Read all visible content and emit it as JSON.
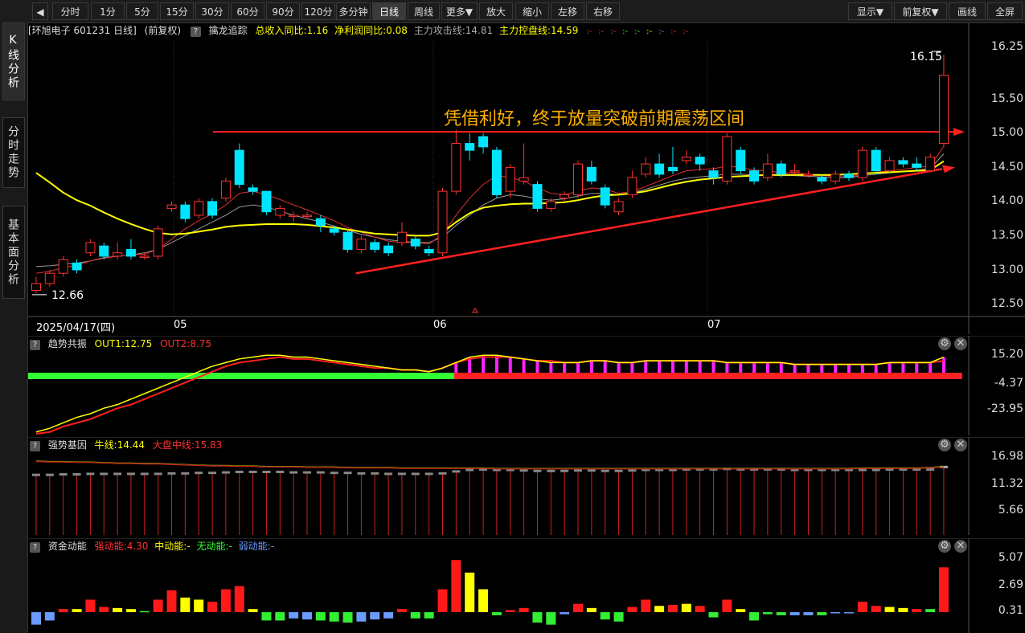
{
  "toolbar": {
    "back_icon": "◀",
    "periods": [
      "分时",
      "1分",
      "5分",
      "15分",
      "30分",
      "60分",
      "90分",
      "120分",
      "多分钟",
      "日线",
      "周线",
      "更多▼",
      "放大",
      "缩小",
      "左移",
      "右移"
    ],
    "active_period": "日线",
    "right": [
      "显示▼",
      "前复权▼",
      "画线",
      "全屏"
    ]
  },
  "sidebar": {
    "tabs": [
      "K线分析",
      "分时走势",
      "基本面分析"
    ],
    "active": 0
  },
  "main": {
    "header": {
      "stock": "[环旭电子 601231 日线]",
      "adjust": "(前复权)",
      "indicator": "擒龙追踪",
      "items": [
        {
          "text": "总收入同比:1.16",
          "color": "#ffff00"
        },
        {
          "text": "净利润同比:0.08",
          "color": "#ffff00"
        },
        {
          "text": "主力攻击线:14.81",
          "color": "#bbbbbb"
        },
        {
          "text": "主力控盘线:14.59",
          "color": "#ffff00"
        }
      ],
      "dashes": [
        ":-",
        ":-",
        ":-",
        ":-",
        ":-",
        ":-",
        ":-",
        ":-",
        ":-"
      ]
    },
    "annotation": "凭借利好，终于放量突破前期震荡区间",
    "high_label": "16.15",
    "low_label": "12.66",
    "y_ticks": [
      "16.25",
      "15.50",
      "15.00",
      "14.50",
      "14.00",
      "13.50",
      "13.00",
      "12.50"
    ],
    "date_labels": [
      "2025/04/17(四)",
      "05",
      "06",
      "07"
    ]
  },
  "panel2": {
    "name": "趋势共振",
    "out1": "OUT1:12.75",
    "out2": "OUT2:8.75",
    "y_ticks": [
      "15.20",
      "-4.37",
      "-23.95"
    ]
  },
  "panel3": {
    "name": "强势基因",
    "bull": "牛线:14.44",
    "market": "大盘中线:15.83",
    "y_ticks": [
      "16.98",
      "11.32",
      "5.66"
    ]
  },
  "panel4": {
    "name": "资金动能",
    "strong": "强动能:4.30",
    "mid": "中动能:-",
    "none": "无动能:-",
    "weak": "弱动能:-",
    "y_ticks": [
      "5.07",
      "2.69",
      "0.31"
    ]
  },
  "colors": {
    "up": "#ff3232",
    "down": "#00e5ff",
    "ma_yellow": "#ffff00",
    "annotation": "#ffb000",
    "arrow": "#ff2020"
  },
  "chart_data": {
    "type": "candlestick",
    "candles": [
      {
        "o": 12.7,
        "c": 12.8,
        "h": 12.9,
        "l": 12.66
      },
      {
        "o": 12.8,
        "c": 12.95,
        "h": 13.0,
        "l": 12.75
      },
      {
        "o": 12.95,
        "c": 13.15,
        "h": 13.2,
        "l": 12.9
      },
      {
        "o": 13.1,
        "c": 13.0,
        "h": 13.15,
        "l": 12.95
      },
      {
        "o": 13.25,
        "c": 13.4,
        "h": 13.45,
        "l": 13.2
      },
      {
        "o": 13.35,
        "c": 13.2,
        "h": 13.4,
        "l": 13.15
      },
      {
        "o": 13.2,
        "c": 13.25,
        "h": 13.4,
        "l": 13.15
      },
      {
        "o": 13.3,
        "c": 13.2,
        "h": 13.45,
        "l": 13.15
      },
      {
        "o": 13.2,
        "c": 13.2,
        "h": 13.25,
        "l": 13.15
      },
      {
        "o": 13.2,
        "c": 13.6,
        "h": 13.65,
        "l": 13.15
      },
      {
        "o": 13.9,
        "c": 13.95,
        "h": 14.0,
        "l": 13.85
      },
      {
        "o": 13.95,
        "c": 13.75,
        "h": 14.0,
        "l": 13.7
      },
      {
        "o": 13.8,
        "c": 14.0,
        "h": 14.05,
        "l": 13.75
      },
      {
        "o": 14.0,
        "c": 13.8,
        "h": 14.05,
        "l": 13.75
      },
      {
        "o": 14.05,
        "c": 14.3,
        "h": 14.35,
        "l": 14.0
      },
      {
        "o": 14.75,
        "c": 14.25,
        "h": 14.85,
        "l": 14.2
      },
      {
        "o": 14.2,
        "c": 14.15,
        "h": 14.25,
        "l": 14.1
      },
      {
        "o": 14.15,
        "c": 13.85,
        "h": 14.15,
        "l": 13.8
      },
      {
        "o": 13.8,
        "c": 13.9,
        "h": 13.95,
        "l": 13.75
      },
      {
        "o": 13.8,
        "c": 13.8,
        "h": 13.85,
        "l": 13.7
      },
      {
        "o": 13.8,
        "c": 13.8,
        "h": 13.85,
        "l": 13.75
      },
      {
        "o": 13.75,
        "c": 13.65,
        "h": 13.8,
        "l": 13.55
      },
      {
        "o": 13.6,
        "c": 13.55,
        "h": 13.65,
        "l": 13.5
      },
      {
        "o": 13.55,
        "c": 13.3,
        "h": 13.6,
        "l": 13.25
      },
      {
        "o": 13.3,
        "c": 13.45,
        "h": 13.5,
        "l": 13.25
      },
      {
        "o": 13.4,
        "c": 13.3,
        "h": 13.45,
        "l": 13.25
      },
      {
        "o": 13.35,
        "c": 13.25,
        "h": 13.4,
        "l": 13.2
      },
      {
        "o": 13.4,
        "c": 13.55,
        "h": 13.7,
        "l": 13.35
      },
      {
        "o": 13.45,
        "c": 13.35,
        "h": 13.5,
        "l": 13.3
      },
      {
        "o": 13.3,
        "c": 13.25,
        "h": 13.35,
        "l": 13.2
      },
      {
        "o": 13.25,
        "c": 14.15,
        "h": 14.2,
        "l": 13.2
      },
      {
        "o": 14.15,
        "c": 14.85,
        "h": 15.05,
        "l": 14.1
      },
      {
        "o": 14.85,
        "c": 14.75,
        "h": 15.0,
        "l": 14.6
      },
      {
        "o": 14.95,
        "c": 14.8,
        "h": 15.0,
        "l": 14.7
      },
      {
        "o": 14.75,
        "c": 14.1,
        "h": 14.8,
        "l": 14.05
      },
      {
        "o": 14.15,
        "c": 14.5,
        "h": 14.55,
        "l": 14.05
      },
      {
        "o": 14.3,
        "c": 14.35,
        "h": 14.85,
        "l": 14.25
      },
      {
        "o": 14.25,
        "c": 13.9,
        "h": 14.3,
        "l": 13.85
      },
      {
        "o": 13.9,
        "c": 14.0,
        "h": 14.05,
        "l": 13.85
      },
      {
        "o": 14.05,
        "c": 14.1,
        "h": 14.15,
        "l": 14.0
      },
      {
        "o": 14.1,
        "c": 14.55,
        "h": 14.6,
        "l": 14.05
      },
      {
        "o": 14.5,
        "c": 14.3,
        "h": 14.6,
        "l": 14.25
      },
      {
        "o": 14.2,
        "c": 13.95,
        "h": 14.25,
        "l": 13.9
      },
      {
        "o": 13.85,
        "c": 14.0,
        "h": 14.05,
        "l": 13.8
      },
      {
        "o": 14.1,
        "c": 14.35,
        "h": 14.45,
        "l": 14.05
      },
      {
        "o": 14.4,
        "c": 14.55,
        "h": 14.65,
        "l": 14.35
      },
      {
        "o": 14.55,
        "c": 14.4,
        "h": 14.7,
        "l": 14.35
      },
      {
        "o": 14.5,
        "c": 14.45,
        "h": 14.8,
        "l": 14.4
      },
      {
        "o": 14.6,
        "c": 14.65,
        "h": 14.75,
        "l": 14.55
      },
      {
        "o": 14.65,
        "c": 14.55,
        "h": 14.7,
        "l": 14.45
      },
      {
        "o": 14.45,
        "c": 14.35,
        "h": 14.5,
        "l": 14.25
      },
      {
        "o": 14.3,
        "c": 14.95,
        "h": 15.0,
        "l": 14.25
      },
      {
        "o": 14.75,
        "c": 14.45,
        "h": 14.8,
        "l": 14.4
      },
      {
        "o": 14.45,
        "c": 14.3,
        "h": 14.5,
        "l": 14.25
      },
      {
        "o": 14.35,
        "c": 14.55,
        "h": 14.7,
        "l": 14.3
      },
      {
        "o": 14.55,
        "c": 14.4,
        "h": 14.6,
        "l": 14.35
      },
      {
        "o": 14.45,
        "c": 14.45,
        "h": 14.55,
        "l": 14.4
      },
      {
        "o": 14.4,
        "c": 14.4,
        "h": 14.45,
        "l": 14.35
      },
      {
        "o": 14.35,
        "c": 14.3,
        "h": 14.4,
        "l": 14.25
      },
      {
        "o": 14.3,
        "c": 14.4,
        "h": 14.45,
        "l": 14.25
      },
      {
        "o": 14.4,
        "c": 14.35,
        "h": 14.45,
        "l": 14.3
      },
      {
        "o": 14.35,
        "c": 14.75,
        "h": 14.8,
        "l": 14.3
      },
      {
        "o": 14.75,
        "c": 14.45,
        "h": 14.8,
        "l": 14.4
      },
      {
        "o": 14.45,
        "c": 14.6,
        "h": 14.65,
        "l": 14.4
      },
      {
        "o": 14.6,
        "c": 14.55,
        "h": 14.65,
        "l": 14.5
      },
      {
        "o": 14.55,
        "c": 14.5,
        "h": 14.65,
        "l": 14.45
      },
      {
        "o": 14.45,
        "c": 14.65,
        "h": 14.7,
        "l": 14.45
      },
      {
        "o": 14.85,
        "c": 15.85,
        "h": 16.15,
        "l": 14.8
      }
    ],
    "ma_yellow": [
      14.42,
      14.28,
      14.13,
      14.02,
      13.94,
      13.84,
      13.75,
      13.67,
      13.6,
      13.54,
      13.52,
      13.53,
      13.56,
      13.59,
      13.63,
      13.65,
      13.66,
      13.67,
      13.67,
      13.67,
      13.66,
      13.64,
      13.62,
      13.59,
      13.56,
      13.53,
      13.52,
      13.51,
      13.5,
      13.5,
      13.55,
      13.7,
      13.83,
      13.91,
      13.94,
      13.96,
      13.97,
      13.97,
      13.98,
      13.99,
      14.02,
      14.06,
      14.09,
      14.1,
      14.12,
      14.15,
      14.2,
      14.25,
      14.29,
      14.32,
      14.34,
      14.36,
      14.37,
      14.38,
      14.39,
      14.39,
      14.39,
      14.39,
      14.39,
      14.39,
      14.4,
      14.41,
      14.42,
      14.43,
      14.44,
      14.45,
      14.46,
      14.59
    ],
    "ma_red": [
      12.95,
      12.98,
      13.03,
      13.07,
      13.13,
      13.17,
      13.2,
      13.22,
      13.23,
      13.3,
      13.45,
      13.6,
      13.72,
      13.82,
      13.95,
      14.12,
      14.15,
      14.1,
      14.03,
      13.95,
      13.88,
      13.8,
      13.72,
      13.62,
      13.55,
      13.48,
      13.42,
      13.4,
      13.4,
      13.38,
      13.52,
      13.8,
      14.05,
      14.25,
      14.38,
      14.35,
      14.3,
      14.2,
      14.12,
      14.1,
      14.15,
      14.2,
      14.18,
      14.12,
      14.15,
      14.22,
      14.3,
      14.38,
      14.45,
      14.47,
      14.48,
      14.52,
      14.5,
      14.46,
      14.45,
      14.42,
      14.42,
      14.4,
      14.38,
      14.37,
      14.36,
      14.4,
      14.43,
      14.45,
      14.47,
      14.5,
      14.52,
      14.81
    ],
    "ma_gray": [
      13.05,
      13.06,
      13.08,
      13.1,
      13.13,
      13.18,
      13.2,
      13.22,
      13.25,
      13.3,
      13.4,
      13.5,
      13.6,
      13.7,
      13.8,
      13.92,
      13.95,
      13.92,
      13.86,
      13.8,
      13.75,
      13.7,
      13.64,
      13.58,
      13.52,
      13.48,
      13.44,
      13.42,
      13.4,
      13.4,
      13.48,
      13.65,
      13.8,
      13.95,
      14.05,
      14.1,
      14.08,
      14.04,
      14.02,
      14.04,
      14.08,
      14.12,
      14.12,
      14.1,
      14.13,
      14.18,
      14.24,
      14.3,
      14.34,
      14.36,
      14.38,
      14.4,
      14.4,
      14.39,
      14.39,
      14.38,
      14.38,
      14.37,
      14.36,
      14.35,
      14.35,
      14.38,
      14.4,
      14.42,
      14.44,
      14.46,
      14.48,
      14.7
    ],
    "ylim": [
      12.4,
      16.35
    ],
    "trend_low": {
      "from_index": 23,
      "from": 12.95,
      "to_index": 67,
      "to": 14.5
    },
    "resistance": 15.02,
    "osc_out1": [
      -26,
      -24,
      -21,
      -18,
      -16,
      -13,
      -11,
      -8,
      -5,
      -2,
      1,
      4,
      7,
      10,
      12,
      14,
      15,
      16,
      16,
      15,
      15,
      14,
      13,
      12,
      11,
      10,
      9,
      8,
      8,
      7,
      9,
      12,
      15,
      16,
      16,
      15,
      14,
      13,
      12,
      12,
      12,
      13,
      13,
      12,
      12,
      13,
      13,
      13,
      13,
      13,
      13,
      12,
      12,
      12,
      12,
      12,
      11,
      11,
      11,
      11,
      11,
      11,
      11,
      12,
      12,
      12,
      12,
      15
    ],
    "osc_out2": [
      -27,
      -26,
      -23,
      -21,
      -19,
      -16,
      -13,
      -11,
      -8,
      -5,
      -2,
      1,
      4,
      7,
      10,
      12,
      13,
      14,
      15,
      14,
      14,
      13,
      12,
      11,
      10,
      9,
      9,
      8,
      8,
      7,
      9,
      12,
      14,
      15,
      15,
      15,
      14,
      13,
      13,
      12,
      12,
      13,
      13,
      12,
      12,
      13,
      13,
      13,
      13,
      13,
      13,
      12,
      12,
      12,
      12,
      12,
      11,
      11,
      11,
      11,
      11,
      11,
      11,
      12,
      12,
      12,
      12,
      13
    ],
    "osc_ylim": [
      -27,
      17
    ],
    "gene_gray": [
      14.2,
      14.2,
      14.3,
      14.3,
      14.4,
      14.4,
      14.4,
      14.4,
      14.4,
      14.4,
      14.5,
      14.5,
      14.6,
      14.6,
      14.7,
      14.8,
      14.8,
      14.8,
      14.8,
      14.7,
      14.7,
      14.7,
      14.6,
      14.6,
      14.5,
      14.5,
      14.4,
      14.4,
      14.4,
      14.4,
      14.5,
      14.9,
      15.2,
      15.3,
      15.2,
      15.2,
      15.1,
      15.0,
      15.0,
      15.0,
      15.1,
      15.1,
      15.0,
      15.0,
      15.1,
      15.2,
      15.2,
      15.2,
      15.3,
      15.3,
      15.3,
      15.4,
      15.3,
      15.3,
      15.3,
      15.3,
      15.2,
      15.2,
      15.2,
      15.2,
      15.2,
      15.2,
      15.2,
      15.3,
      15.3,
      15.3,
      15.3,
      15.8
    ],
    "gene_line": [
      16.9,
      16.8,
      16.8,
      16.7,
      16.7,
      16.6,
      16.5,
      16.5,
      16.4,
      16.4,
      16.3,
      16.2,
      16.1,
      16.0,
      16.0,
      15.9,
      15.9,
      15.8,
      15.8,
      15.8,
      15.7,
      15.7,
      15.7,
      15.6,
      15.6,
      15.6,
      15.6,
      15.5,
      15.5,
      15.5,
      15.5,
      15.5,
      15.5,
      15.5,
      15.4,
      15.4,
      15.4,
      15.4,
      15.4,
      15.4,
      15.4,
      15.4,
      15.4,
      15.4,
      15.4,
      15.4,
      15.4,
      15.4,
      15.4,
      15.4,
      15.4,
      15.4,
      15.4,
      15.4,
      15.4,
      15.4,
      15.4,
      15.4,
      15.4,
      15.4,
      15.4,
      15.5,
      15.5,
      15.5,
      15.5,
      15.5,
      15.6,
      15.8
    ],
    "gene_ylim": [
      2.0,
      18.3
    ],
    "energy": [
      {
        "v": -1.2,
        "c": "blue"
      },
      {
        "v": -0.8,
        "c": "blue"
      },
      {
        "v": 0.3,
        "c": "red"
      },
      {
        "v": 0.3,
        "c": "yellow"
      },
      {
        "v": 1.2,
        "c": "red"
      },
      {
        "v": 0.5,
        "c": "red"
      },
      {
        "v": 0.4,
        "c": "yellow"
      },
      {
        "v": 0.3,
        "c": "yellow"
      },
      {
        "v": 0.1,
        "c": "green"
      },
      {
        "v": 1.2,
        "c": "red"
      },
      {
        "v": 2.1,
        "c": "red"
      },
      {
        "v": 1.4,
        "c": "yellow"
      },
      {
        "v": 1.2,
        "c": "yellow"
      },
      {
        "v": 1.0,
        "c": "red"
      },
      {
        "v": 2.2,
        "c": "red"
      },
      {
        "v": 2.5,
        "c": "red"
      },
      {
        "v": 0.3,
        "c": "yellow"
      },
      {
        "v": -0.8,
        "c": "green"
      },
      {
        "v": -0.8,
        "c": "green"
      },
      {
        "v": -0.6,
        "c": "blue"
      },
      {
        "v": -0.7,
        "c": "blue"
      },
      {
        "v": -0.8,
        "c": "green"
      },
      {
        "v": -0.9,
        "c": "green"
      },
      {
        "v": -1.0,
        "c": "green"
      },
      {
        "v": -0.9,
        "c": "blue"
      },
      {
        "v": -0.7,
        "c": "blue"
      },
      {
        "v": -0.6,
        "c": "blue"
      },
      {
        "v": 0.3,
        "c": "red"
      },
      {
        "v": -0.6,
        "c": "green"
      },
      {
        "v": -0.6,
        "c": "green"
      },
      {
        "v": 2.2,
        "c": "red"
      },
      {
        "v": 5.0,
        "c": "red"
      },
      {
        "v": 3.8,
        "c": "yellow"
      },
      {
        "v": 2.2,
        "c": "yellow"
      },
      {
        "v": -0.3,
        "c": "green"
      },
      {
        "v": 0.2,
        "c": "red"
      },
      {
        "v": 0.4,
        "c": "red"
      },
      {
        "v": -1.0,
        "c": "green"
      },
      {
        "v": -1.2,
        "c": "green"
      },
      {
        "v": -0.2,
        "c": "blue"
      },
      {
        "v": 0.8,
        "c": "red"
      },
      {
        "v": 0.4,
        "c": "yellow"
      },
      {
        "v": -0.7,
        "c": "green"
      },
      {
        "v": -0.9,
        "c": "green"
      },
      {
        "v": 0.5,
        "c": "red"
      },
      {
        "v": 1.2,
        "c": "red"
      },
      {
        "v": 0.6,
        "c": "yellow"
      },
      {
        "v": 0.7,
        "c": "red"
      },
      {
        "v": 0.8,
        "c": "yellow"
      },
      {
        "v": 0.6,
        "c": "red"
      },
      {
        "v": -0.5,
        "c": "green"
      },
      {
        "v": 1.2,
        "c": "red"
      },
      {
        "v": 0.3,
        "c": "yellow"
      },
      {
        "v": -0.8,
        "c": "green"
      },
      {
        "v": -0.2,
        "c": "green"
      },
      {
        "v": -0.3,
        "c": "green"
      },
      {
        "v": -0.3,
        "c": "blue"
      },
      {
        "v": -0.3,
        "c": "blue"
      },
      {
        "v": -0.3,
        "c": "green"
      },
      {
        "v": -0.1,
        "c": "blue"
      },
      {
        "v": -0.1,
        "c": "blue"
      },
      {
        "v": 1.0,
        "c": "red"
      },
      {
        "v": 0.6,
        "c": "red"
      },
      {
        "v": 0.5,
        "c": "yellow"
      },
      {
        "v": 0.4,
        "c": "yellow"
      },
      {
        "v": 0.3,
        "c": "red"
      },
      {
        "v": 0.3,
        "c": "green"
      },
      {
        "v": 4.3,
        "c": "red"
      }
    ],
    "energy_ylim": [
      -2.0,
      5.4
    ]
  }
}
